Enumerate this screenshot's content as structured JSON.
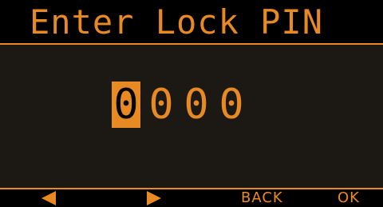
{
  "screen": {
    "title": "Enter Lock PIN",
    "pin_digits": [
      "0",
      "0",
      "0",
      "0"
    ],
    "selected_digit_index": 0
  },
  "buttons": {
    "left_icon": "left-arrow-icon",
    "right_icon": "right-arrow-icon",
    "back_label": "BACK",
    "ok_label": "OK"
  },
  "colors": {
    "accent": "#e88a24",
    "background": "#1c1813",
    "bar_background": "#000000"
  }
}
